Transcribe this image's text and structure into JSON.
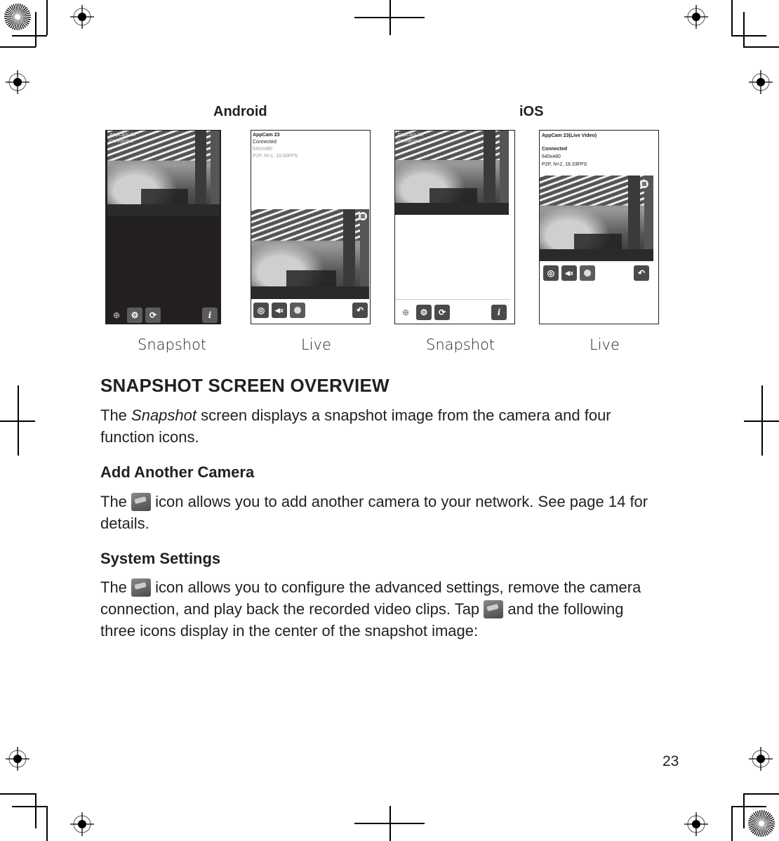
{
  "figure": {
    "platform_labels": [
      "Android",
      "iOS"
    ],
    "captions": [
      "Snapshot",
      "Live",
      "Snapshot",
      "Live"
    ],
    "android_snapshot": {
      "overlay_lines": [
        "AppCam 23",
        "Connected"
      ],
      "icons": [
        "add-camera-icon",
        "system-settings-icon",
        "refresh-icon",
        "info-icon"
      ],
      "info_glyph": "i"
    },
    "android_live": {
      "title": "AppCam 23",
      "status": "Connected",
      "resolution": "640X480",
      "stream": "P2P, N=1, 19.00FPS",
      "icons": [
        "snapshot-camera-icon",
        "mute-icon",
        "record-icon",
        "back-icon"
      ],
      "mute_glyph": "◀x",
      "back_glyph": "↶"
    },
    "ios_snapshot": {
      "overlay_lines": [
        "AppCam 23",
        "Connected"
      ],
      "icons": [
        "add-camera-icon",
        "system-settings-icon",
        "refresh-icon",
        "info-icon"
      ],
      "info_glyph": "i"
    },
    "ios_live": {
      "title": "AppCam 23(Live Video)",
      "status": "Connected",
      "resolution": "640x480",
      "stream": "P2P, N=2, 18.33FPS",
      "icons": [
        "snapshot-camera-icon",
        "mute-icon",
        "record-icon",
        "back-icon"
      ],
      "mute_glyph": "◀x",
      "back_glyph": "↶"
    }
  },
  "section": {
    "title": "SNAPSHOT SCREEN OVERVIEW",
    "intro": {
      "before": "The ",
      "emphasis": "Snapshot",
      "after": " screen displays a snapshot image from the camera and four",
      "line2": "function icons."
    }
  },
  "add_camera": {
    "heading": "Add Another Camera",
    "before_icon": "The ",
    "after_icon": " icon allows you to add another camera to your network. See page 14 for",
    "line2": "details."
  },
  "system_settings": {
    "heading": "System Settings",
    "before_icon": "The ",
    "after_icon": " icon allows you to configure the advanced settings, remove the camera",
    "line2_before": "connection, and play back the recorded video clips. Tap ",
    "line2_after": " and the following",
    "line3": "three icons display in the center of the snapshot image:"
  },
  "page_number": "23"
}
